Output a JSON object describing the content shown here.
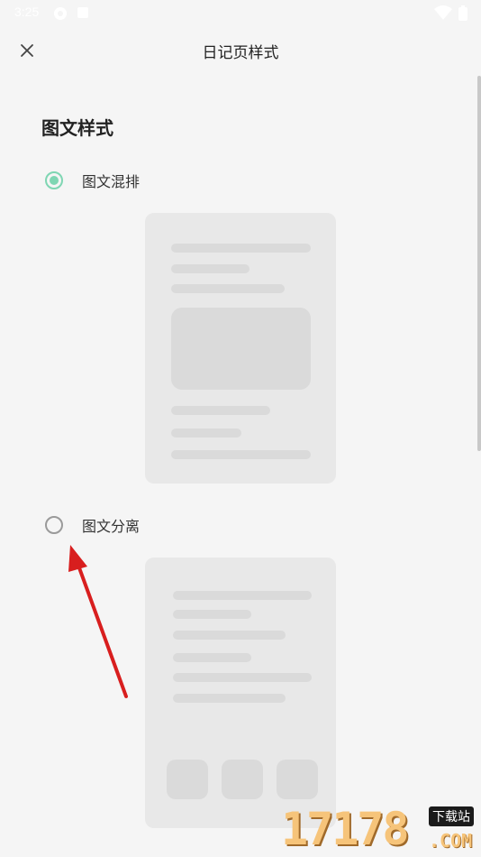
{
  "status_bar": {
    "time": "3:25"
  },
  "header": {
    "title": "日记页样式",
    "close_icon": "close-icon"
  },
  "section": {
    "title": "图文样式"
  },
  "options": [
    {
      "label": "图文混排",
      "selected": true
    },
    {
      "label": "图文分离",
      "selected": false
    }
  ],
  "colors": {
    "accent": "#7fd6b3",
    "background": "#f5f5f5",
    "card": "#e8e8e8",
    "placeholder": "#dadada",
    "annotation_arrow": "#d81e1e"
  },
  "watermark": {
    "digits": "17178",
    "tag": "下载站",
    "suffix": ".COM"
  }
}
